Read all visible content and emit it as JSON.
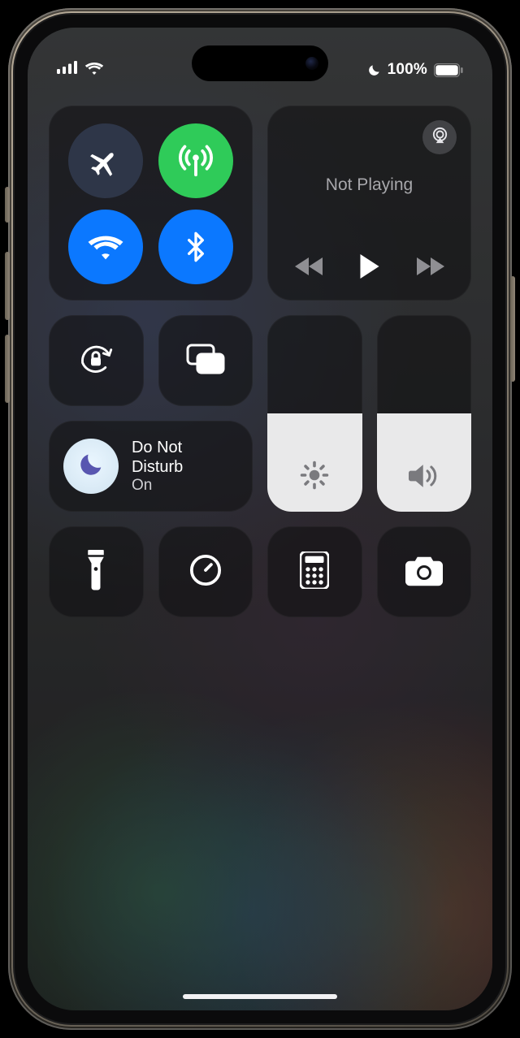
{
  "status": {
    "battery_pct": "100%",
    "dnd_active": true,
    "signal_bars": 4,
    "wifi": true
  },
  "connectivity": {
    "airplane": {
      "on": false,
      "icon": "airplane-icon",
      "color": "dark"
    },
    "cellular": {
      "on": true,
      "icon": "antenna-icon",
      "color": "green"
    },
    "wifi": {
      "on": true,
      "icon": "wifi-icon",
      "color": "blue"
    },
    "bluetooth": {
      "on": true,
      "icon": "bluetooth-icon",
      "color": "blue"
    }
  },
  "media": {
    "title": "Not Playing",
    "prev_icon": "skip-back-icon",
    "play_icon": "play-icon",
    "next_icon": "skip-forward-icon",
    "airplay_icon": "airplay-icon"
  },
  "orientation_lock": {
    "icon": "lock-rotate-icon"
  },
  "screen_mirroring": {
    "icon": "screen-mirror-icon"
  },
  "focus": {
    "name": "Do Not Disturb",
    "state": "On",
    "icon": "moon-icon"
  },
  "brightness": {
    "value_pct": 50,
    "icon": "sun-icon"
  },
  "volume": {
    "value_pct": 50,
    "icon": "speaker-icon"
  },
  "shortcuts": [
    {
      "id": "flashlight",
      "icon": "flashlight-icon"
    },
    {
      "id": "timer",
      "icon": "timer-icon"
    },
    {
      "id": "calculator",
      "icon": "calculator-icon"
    },
    {
      "id": "camera",
      "icon": "camera-icon"
    }
  ],
  "colors": {
    "blue": "#0b78ff",
    "green": "#2fcb59",
    "tile": "rgba(18,18,20,.62)"
  }
}
